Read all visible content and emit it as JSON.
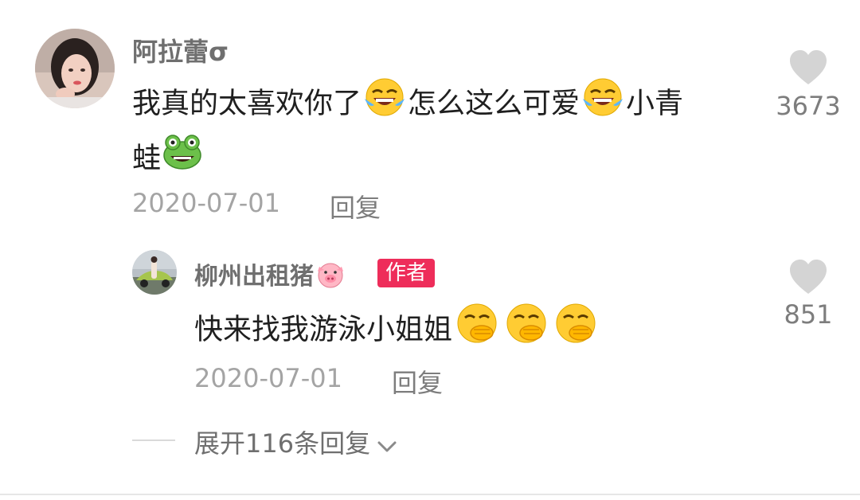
{
  "comment": {
    "username": "阿拉蕾σ",
    "text_parts": [
      "我真的太喜欢你了",
      "怎么这么可爱",
      "小青",
      "蛙"
    ],
    "emoji_names": [
      "rolling-laugh-emoji",
      "rolling-laugh-emoji",
      "frog-emoji"
    ],
    "date": "2020-07-01",
    "reply_label": "回复",
    "like_count": "3673"
  },
  "reply": {
    "username": "柳州出租猪",
    "username_emoji": "pig-face-emoji",
    "badge": "作者",
    "text": "快来找我游泳小姐姐",
    "emoji_names": [
      "hand-over-mouth-emoji",
      "hand-over-mouth-emoji",
      "hand-over-mouth-emoji"
    ],
    "date": "2020-07-01",
    "reply_label": "回复",
    "like_count": "851"
  },
  "expand": {
    "label": "展开116条回复",
    "icon": "chevron-down-icon"
  },
  "colors": {
    "like_heart": "#d4d4d4",
    "badge_bg": "#ee2d5a",
    "username": "#6f6f6f",
    "meta": "#a4a4a4"
  }
}
